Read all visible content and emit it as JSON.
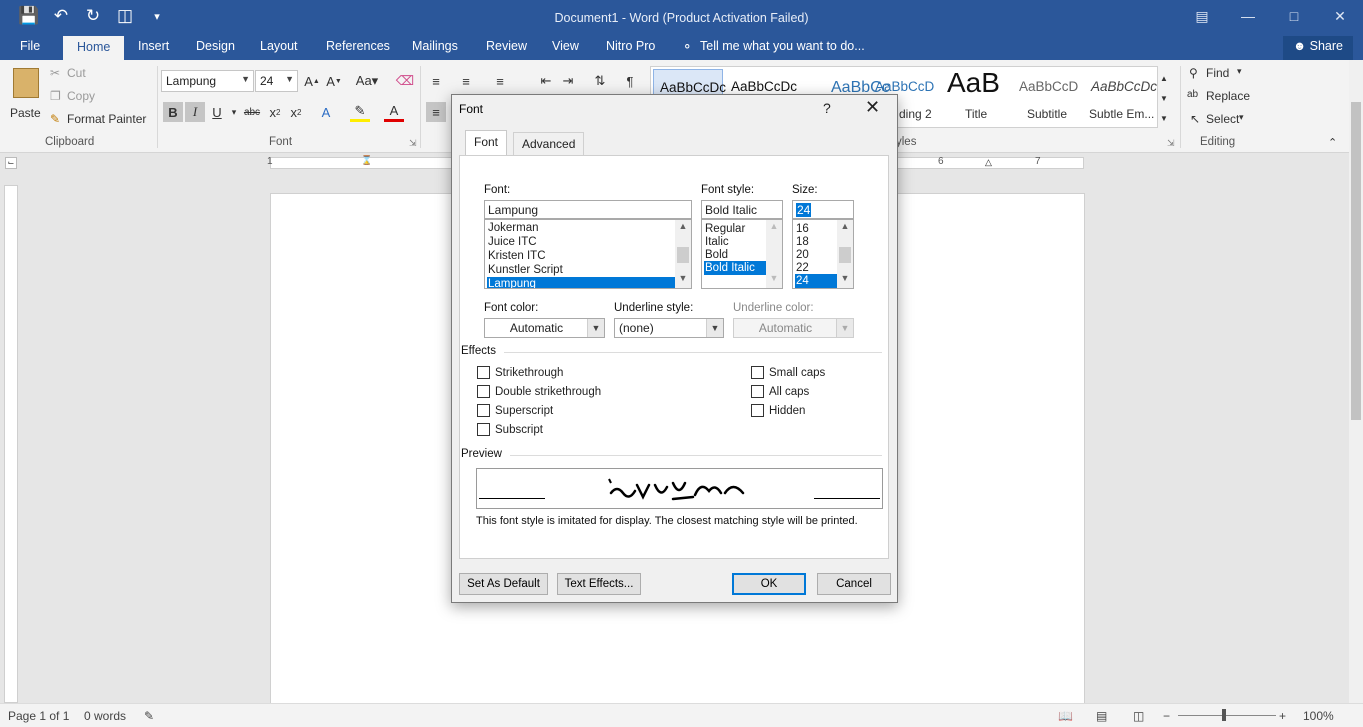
{
  "window": {
    "title": "Document1 - Word (Product Activation Failed)"
  },
  "ribbon_tabs": [
    {
      "label": "File"
    },
    {
      "label": "Home"
    },
    {
      "label": "Insert"
    },
    {
      "label": "Design"
    },
    {
      "label": "Layout"
    },
    {
      "label": "References"
    },
    {
      "label": "Mailings"
    },
    {
      "label": "Review"
    },
    {
      "label": "View"
    },
    {
      "label": "Nitro Pro"
    }
  ],
  "tell_me": "Tell me what you want to do...",
  "share_label": "Share",
  "clipboard": {
    "paste": "Paste",
    "cut": "Cut",
    "copy": "Copy",
    "format_painter": "Format Painter",
    "group_label": "Clipboard"
  },
  "font_group": {
    "font_name": "Lampung",
    "font_size": "24",
    "group_label": "Font"
  },
  "styles_group": {
    "items": [
      {
        "preview": "AaBbCcDc",
        "name": ""
      },
      {
        "preview": "AaBbCcDc",
        "name": ""
      },
      {
        "preview": "AaBbCc",
        "name": ""
      },
      {
        "preview": "AaBbCcD",
        "name": "ding 2"
      },
      {
        "preview": "AaB",
        "name": "Title"
      },
      {
        "preview": "AaBbCcD",
        "name": "Subtitle"
      },
      {
        "preview": "AaBbCcDc",
        "name": "Subtle Em..."
      }
    ],
    "group_label": "yles"
  },
  "editing": {
    "find": "Find",
    "replace": "Replace",
    "select": "Select",
    "group_label": "Editing"
  },
  "ruler_numbers": [
    "1",
    "6",
    "7"
  ],
  "status": {
    "page": "Page 1 of 1",
    "words": "0 words",
    "zoom": "100%"
  },
  "dialog": {
    "title": "Font",
    "help": "?",
    "tabs": [
      {
        "label": "Font"
      },
      {
        "label": "Advanced"
      }
    ],
    "font_label": "Font:",
    "font_value": "Lampung",
    "font_list": [
      "Jokerman",
      "Juice ITC",
      "Kristen ITC",
      "Kunstler Script",
      "Lampung"
    ],
    "style_label": "Font style:",
    "style_value": "Bold Italic",
    "style_list": [
      "Regular",
      "Italic",
      "Bold",
      "Bold Italic"
    ],
    "size_label": "Size:",
    "size_value": "24",
    "size_list": [
      "16",
      "18",
      "20",
      "22",
      "24"
    ],
    "font_color_label": "Font color:",
    "font_color_value": "Automatic",
    "underline_style_label": "Underline style:",
    "underline_style_value": "(none)",
    "underline_color_label": "Underline color:",
    "underline_color_value": "Automatic",
    "effects_label": "Effects",
    "effects_left": [
      "Strikethrough",
      "Double strikethrough",
      "Superscript",
      "Subscript"
    ],
    "effects_right": [
      "Small caps",
      "All caps",
      "Hidden"
    ],
    "preview_label": "Preview",
    "note": "This font style is imitated for display. The closest matching style will be printed.",
    "buttons": {
      "set_default": "Set As Default",
      "text_effects": "Text Effects...",
      "ok": "OK",
      "cancel": "Cancel"
    }
  },
  "colors": {
    "word_blue": "#2b579a",
    "selection_blue": "#0078d7"
  }
}
